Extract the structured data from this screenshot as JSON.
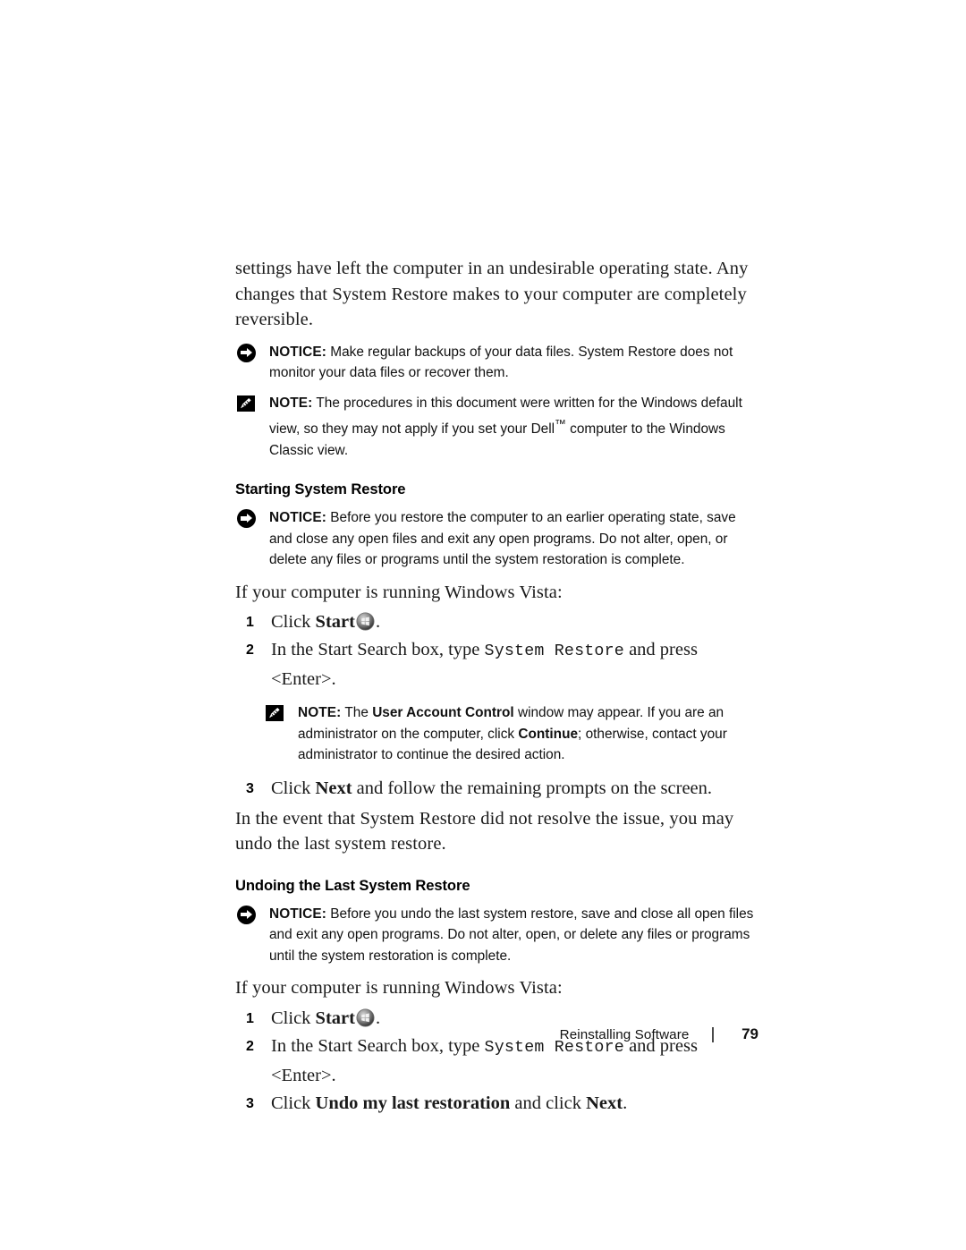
{
  "page": {
    "footer_title": "Reinstalling Software",
    "footer_separator": "|",
    "page_number": "79"
  },
  "content": {
    "intro_paragraph": "settings have left the computer in an undesirable operating state. Any changes that System Restore makes to your computer are completely reversible.",
    "notice_1": {
      "icon": "notice-arrow-icon",
      "label": "NOTICE:",
      "text": " Make regular backups of your data files. System Restore does not monitor your data files or recover them."
    },
    "note_1": {
      "icon": "note-pencil-icon",
      "label": "NOTE:",
      "text_part_1": " The procedures in this document were written for the Windows default view, so they may not apply if you set your Dell",
      "trademark": "™",
      "text_part_2": " computer to the Windows Classic view."
    },
    "heading_starting": "Starting System Restore",
    "notice_2": {
      "icon": "notice-arrow-icon",
      "label": "NOTICE:",
      "text": " Before you restore the computer to an earlier operating state, save and close any open files and exit any open programs. Do not alter, open, or delete any files or programs until the system restoration is complete."
    },
    "vista_lead_1": "If your computer is running Windows Vista:",
    "steps_starting": [
      {
        "number": "1",
        "text_before": "Click ",
        "bold_1": "Start",
        "icon": "windows-start-orb-icon",
        "text_after": "."
      },
      {
        "number": "2",
        "text_before": "In the Start Search box, type ",
        "mono": "System  Restore",
        "text_after": " and press <Enter>."
      },
      {
        "number": "3",
        "text_before": "Click ",
        "bold_1": "Next",
        "text_after": " and follow the remaining prompts on the screen."
      }
    ],
    "note_2": {
      "icon": "note-pencil-icon",
      "label": "NOTE:",
      "text_part_1": " The ",
      "bold_1": "User Account Control",
      "text_part_2": " window may appear. If you are an administrator on the computer, click ",
      "bold_2": "Continue",
      "text_part_3": "; otherwise, contact your administrator to continue the desired action."
    },
    "undo_paragraph": "In the event that System Restore did not resolve the issue, you may undo the last system restore.",
    "heading_undoing": "Undoing the Last System Restore",
    "notice_3": {
      "icon": "notice-arrow-icon",
      "label": "NOTICE:",
      "text": " Before you undo the last system restore, save and close all open files and exit any open programs. Do not alter, open, or delete any files or programs until the system restoration is complete."
    },
    "vista_lead_2": "If your computer is running Windows Vista:",
    "steps_undoing": [
      {
        "number": "1",
        "text_before": "Click ",
        "bold_1": "Start",
        "icon": "windows-start-orb-icon",
        "text_after": "."
      },
      {
        "number": "2",
        "text_before": "In the Start Search box, type ",
        "mono": "System  Restore",
        "text_after": " and press <Enter>."
      },
      {
        "number": "3",
        "text_before": "Click ",
        "bold_1": "Undo my last restoration",
        "text_after": " and click ",
        "bold_2": "Next",
        "text_end": "."
      }
    ]
  },
  "colors": {
    "text": "#1a1a1a",
    "icon_fill": "#000000",
    "page_background": "#ffffff"
  }
}
